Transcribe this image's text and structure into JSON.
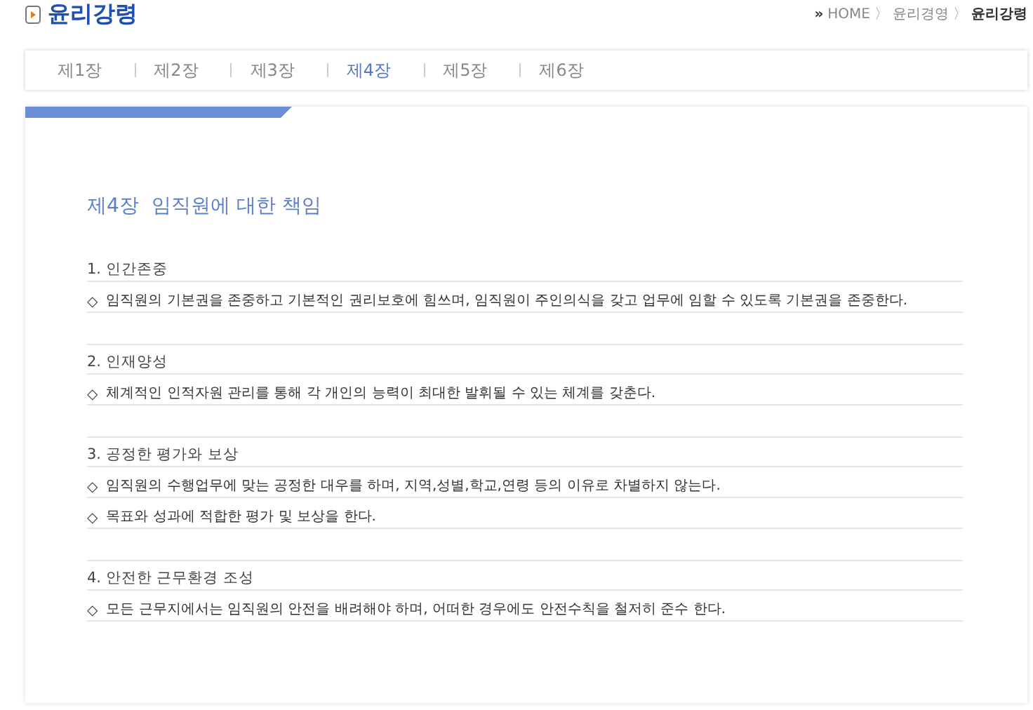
{
  "page_title": "윤리강령",
  "breadcrumb": [
    {
      "kind": "marker",
      "text": "»"
    },
    {
      "kind": "link",
      "text": "HOME"
    },
    {
      "kind": "separator",
      "text": "〉"
    },
    {
      "kind": "link",
      "text": "윤리경영"
    },
    {
      "kind": "separator",
      "text": "〉"
    },
    {
      "kind": "current",
      "text": "윤리강령"
    }
  ],
  "tabs": [
    {
      "label": "제1장",
      "selected": false
    },
    {
      "label": "제2장",
      "selected": false
    },
    {
      "label": "제3장",
      "selected": false
    },
    {
      "label": "제4장",
      "selected": true
    },
    {
      "label": "제5장",
      "selected": false
    },
    {
      "label": "제6장",
      "selected": false
    }
  ],
  "chapter": {
    "number": "제4장",
    "title": "임직원에 대한 책임"
  },
  "sections": [
    {
      "heading": "1. 인간존중",
      "items": [
        {
          "marker": "◇",
          "text": "임직원의 기본권을 존중하고 기본적인 권리보호에 힘쓰며, 임직원이 주인의식을 갖고 업무에 임할 수 있도록 기본권을 존중한다."
        }
      ]
    },
    {
      "heading": "2. 인재양성",
      "items": [
        {
          "marker": "◇",
          "text": "체계적인 인적자원 관리를 통해 각 개인의 능력이 최대한 발휘될 수 있는 체계를 갖춘다."
        }
      ]
    },
    {
      "heading": "3. 공정한 평가와 보상",
      "items": [
        {
          "marker": "◇",
          "text": "임직원의 수행업무에 맞는 공정한 대우를 하며, 지역,성별,학교,연령 등의 이유로 차별하지 않는다."
        },
        {
          "marker": "◇",
          "text": "목표와 성과에 적합한 평가 및 보상을 한다."
        }
      ]
    },
    {
      "heading": "4. 안전한 근무환경 조성",
      "items": [
        {
          "marker": "◇",
          "text": "모든 근무지에서는 임직원의 안전을 배려해야 하며, 어떠한 경우에도 안전수칙을 철저히 준수 한다."
        }
      ]
    }
  ]
}
